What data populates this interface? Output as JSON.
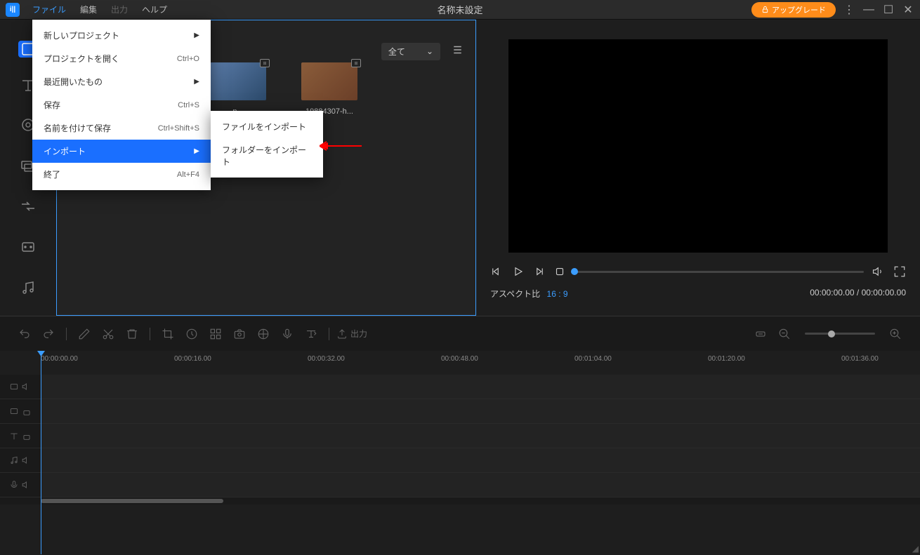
{
  "titlebar": {
    "menus": [
      "ファイル",
      "編集",
      "出力",
      "ヘルプ"
    ],
    "title": "名称未設定",
    "upgrade": "アップグレード"
  },
  "dropdown": {
    "items": [
      {
        "label": "新しいプロジェクト",
        "shortcut": "",
        "arrow": true
      },
      {
        "label": "プロジェクトを開く",
        "shortcut": "Ctrl+O",
        "arrow": false
      },
      {
        "label": "最近開いたもの",
        "shortcut": "",
        "arrow": true
      },
      {
        "label": "保存",
        "shortcut": "Ctrl+S",
        "arrow": false
      },
      {
        "label": "名前を付けて保存",
        "shortcut": "Ctrl+Shift+S",
        "arrow": false
      },
      {
        "label": "インポート",
        "shortcut": "",
        "arrow": true
      },
      {
        "label": "終了",
        "shortcut": "Alt+F4",
        "arrow": false
      }
    ]
  },
  "submenu": {
    "items": [
      "ファイルをインポート",
      "フォルダーをインポート"
    ]
  },
  "media": {
    "filter": "全て",
    "items": [
      {
        "label": "n..."
      },
      {
        "label": "19884307-h..."
      }
    ]
  },
  "preview": {
    "aspect_label": "アスペクト比",
    "aspect_value": "16 : 9",
    "time": "00:00:00.00 / 00:00:00.00"
  },
  "timeline_toolbar": {
    "export": "出力"
  },
  "ruler": {
    "ticks": [
      "00:00:00.00",
      "00:00:16.00",
      "00:00:32.00",
      "00:00:48.00",
      "00:01:04.00",
      "00:01:20.00",
      "00:01:36.00"
    ]
  }
}
